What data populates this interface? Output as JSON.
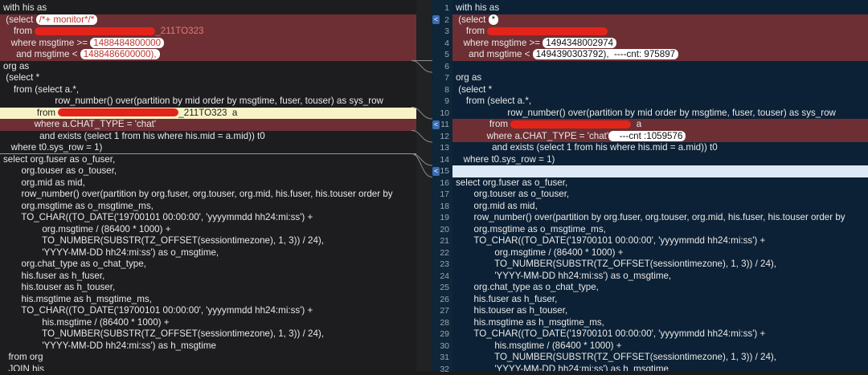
{
  "left": {
    "lines": [
      {
        "text": "with his as",
        "kind": ""
      },
      {
        "pre": " (select ",
        "pill": "/*+ monitor*/*",
        "kind": "del"
      },
      {
        "pre": "    from ",
        "redact": true,
        "post": "_211TO323",
        "kind": "del"
      },
      {
        "pre": "   where msgtime >= ",
        "pill": "1488484800000",
        "kind": "del"
      },
      {
        "pre": "     and msgtime < ",
        "pill": "1488486600000),",
        "kind": "del"
      },
      {
        "text": "org as",
        "kind": ""
      },
      {
        "text": " (select *",
        "kind": ""
      },
      {
        "text": "    from (select a.*,",
        "kind": ""
      },
      {
        "text": "                    row_number() over(partition by mid order by msgtime, fuser, touser) as sys_row",
        "kind": ""
      },
      {
        "pre": "             from ",
        "redact": true,
        "post": "_211TO323  a",
        "kind": "hl"
      },
      {
        "text": "            where a.CHAT_TYPE = 'chat'",
        "kind": "del"
      },
      {
        "text": "              and exists (select 1 from his where his.mid = a.mid)) t0",
        "kind": ""
      },
      {
        "text": "   where t0.sys_row = 1)",
        "kind": ""
      },
      {
        "text": "select org.fuser as o_fuser,",
        "kind": ""
      },
      {
        "text": "       org.touser as o_touser,",
        "kind": ""
      },
      {
        "text": "       org.mid as mid,",
        "kind": ""
      },
      {
        "text": "       row_number() over(partition by org.fuser, org.touser, org.mid, his.fuser, his.touser order by",
        "kind": ""
      },
      {
        "text": "       org.msgtime as o_msgtime_ms,",
        "kind": ""
      },
      {
        "text": "       TO_CHAR((TO_DATE('19700101 00:00:00', 'yyyymmdd hh24:mi:ss') +",
        "kind": ""
      },
      {
        "text": "               org.msgtime / (86400 * 1000) +",
        "kind": ""
      },
      {
        "text": "               TO_NUMBER(SUBSTR(TZ_OFFSET(sessiontimezone), 1, 3)) / 24),",
        "kind": ""
      },
      {
        "text": "               'YYYY-MM-DD hh24:mi:ss') as o_msgtime,",
        "kind": ""
      },
      {
        "text": "       org.chat_type as o_chat_type,",
        "kind": ""
      },
      {
        "text": "       his.fuser as h_fuser,",
        "kind": ""
      },
      {
        "text": "       his.touser as h_touser,",
        "kind": ""
      },
      {
        "text": "       his.msgtime as h_msgtime_ms,",
        "kind": ""
      },
      {
        "text": "       TO_CHAR((TO_DATE('19700101 00:00:00', 'yyyymmdd hh24:mi:ss') +",
        "kind": ""
      },
      {
        "text": "               his.msgtime / (86400 * 1000) +",
        "kind": ""
      },
      {
        "text": "               TO_NUMBER(SUBSTR(TZ_OFFSET(sessiontimezone), 1, 3)) / 24),",
        "kind": ""
      },
      {
        "text": "               'YYYY-MM-DD hh24:mi:ss') as h_msgtime",
        "kind": ""
      },
      {
        "text": "  from org",
        "kind": ""
      },
      {
        "text": "  JOIN his",
        "kind": ""
      }
    ]
  },
  "right": {
    "line_numbers": [
      "1",
      "2",
      "3",
      "4",
      "5",
      "6",
      "7",
      "8",
      "9",
      "10",
      "11",
      "12",
      "13",
      "14",
      "15",
      "16",
      "17",
      "18",
      "19",
      "20",
      "21",
      "22",
      "23",
      "24",
      "25",
      "26",
      "27",
      "28",
      "29",
      "30",
      "31",
      "32"
    ],
    "lines": [
      {
        "text": "with his as",
        "kind": ""
      },
      {
        "pre": " (select ",
        "pill": "*",
        "kind": "ins"
      },
      {
        "pre": "    from ",
        "redact": true,
        "post": "",
        "kind": "ins"
      },
      {
        "pre": "   where msgtime >= ",
        "pill": "1494348002974",
        "kind": "ins"
      },
      {
        "pre": "     and msgtime < ",
        "pill": "1494390303792),  ----cnt: 975897",
        "kind": "ins"
      },
      {
        "text": "",
        "kind": ""
      },
      {
        "text": "org as",
        "kind": ""
      },
      {
        "text": " (select *",
        "kind": ""
      },
      {
        "text": "    from (select a.*,",
        "kind": ""
      },
      {
        "text": "                    row_number() over(partition by mid order by msgtime, fuser, touser) as sys_row",
        "kind": ""
      },
      {
        "pre": "             from ",
        "redact": true,
        "post": "  a",
        "kind": "ins"
      },
      {
        "pre": "            where a.CHAT_TYPE = 'chat'",
        "pill": "   ---cnt :1059576",
        "kind": "ins"
      },
      {
        "text": "              and exists (select 1 from his where his.mid = a.mid)) t0",
        "kind": ""
      },
      {
        "text": "   where t0.sys_row = 1)",
        "kind": ""
      },
      {
        "text": "",
        "kind": "blank"
      },
      {
        "text": "select org.fuser as o_fuser,",
        "kind": ""
      },
      {
        "text": "       org.touser as o_touser,",
        "kind": ""
      },
      {
        "text": "       org.mid as mid,",
        "kind": ""
      },
      {
        "text": "       row_number() over(partition by org.fuser, org.touser, org.mid, his.fuser, his.touser order by",
        "kind": ""
      },
      {
        "text": "       org.msgtime as o_msgtime_ms,",
        "kind": ""
      },
      {
        "text": "       TO_CHAR((TO_DATE('19700101 00:00:00', 'yyyymmdd hh24:mi:ss') +",
        "kind": ""
      },
      {
        "text": "               org.msgtime / (86400 * 1000) +",
        "kind": ""
      },
      {
        "text": "               TO_NUMBER(SUBSTR(TZ_OFFSET(sessiontimezone), 1, 3)) / 24),",
        "kind": ""
      },
      {
        "text": "               'YYYY-MM-DD hh24:mi:ss') as o_msgtime,",
        "kind": ""
      },
      {
        "text": "       org.chat_type as o_chat_type,",
        "kind": ""
      },
      {
        "text": "       his.fuser as h_fuser,",
        "kind": ""
      },
      {
        "text": "       his.touser as h_touser,",
        "kind": ""
      },
      {
        "text": "       his.msgtime as h_msgtime_ms,",
        "kind": ""
      },
      {
        "text": "       TO_CHAR((TO_DATE('19700101 00:00:00', 'yyyymmdd hh24:mi:ss') +",
        "kind": ""
      },
      {
        "text": "               his.msgtime / (86400 * 1000) +",
        "kind": ""
      },
      {
        "text": "               TO_NUMBER(SUBSTR(TZ_OFFSET(sessiontimezone), 1, 3)) / 24),",
        "kind": ""
      },
      {
        "text": "               'YYYY-MM-DD hh24:mi:ss') as h_msgtime",
        "kind": ""
      }
    ]
  },
  "merge_arrow_glyph": "<",
  "colors": {
    "deleted": "#6d2f33",
    "highlight": "#f8f3c6",
    "right_bg": "#0c2135",
    "left_bg": "#1d1d1f"
  }
}
